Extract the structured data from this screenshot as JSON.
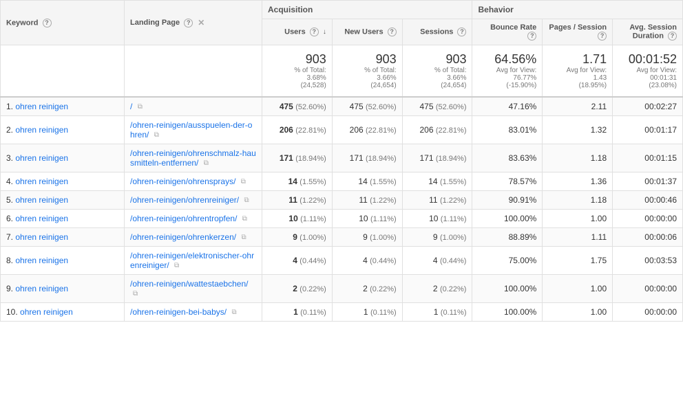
{
  "headers": {
    "keyword_label": "Keyword",
    "landing_label": "Landing Page",
    "acquisition_label": "Acquisition",
    "behavior_label": "Behavior",
    "users_label": "Users",
    "newusers_label": "New Users",
    "sessions_label": "Sessions",
    "bounce_label": "Bounce Rate",
    "pages_label": "Pages / Session",
    "avgdur_label": "Avg. Session Duration"
  },
  "summary": {
    "users": "903",
    "users_sub1": "% of Total:",
    "users_sub2": "3.68%",
    "users_sub3": "(24,528)",
    "newusers": "903",
    "newusers_sub1": "% of Total:",
    "newusers_sub2": "3.66%",
    "newusers_sub3": "(24,654)",
    "sessions": "903",
    "sessions_sub1": "% of Total:",
    "sessions_sub2": "3.66%",
    "sessions_sub3": "(24,654)",
    "bounce": "64.56%",
    "bounce_sub1": "Avg for View:",
    "bounce_sub2": "76.77%",
    "bounce_sub3": "(-15.90%)",
    "pages": "1.71",
    "pages_sub1": "Avg for View:",
    "pages_sub2": "1.43",
    "pages_sub3": "(18.95%)",
    "avgdur": "00:01:52",
    "avgdur_sub1": "Avg for View:",
    "avgdur_sub2": "00:01:31",
    "avgdur_sub3": "(23.08%)"
  },
  "rows": [
    {
      "num": "1.",
      "keyword": "ohren reinigen",
      "landing": "/",
      "users": "475",
      "users_pct": "(52.60%)",
      "newusers": "475",
      "newusers_pct": "(52.60%)",
      "sessions": "475",
      "sessions_pct": "(52.60%)",
      "bounce": "47.16%",
      "pages": "2.11",
      "avgdur": "00:02:27"
    },
    {
      "num": "2.",
      "keyword": "ohren reinigen",
      "landing": "/ohren-reinigen/ausspuelen-der-ohren/",
      "users": "206",
      "users_pct": "(22.81%)",
      "newusers": "206",
      "newusers_pct": "(22.81%)",
      "sessions": "206",
      "sessions_pct": "(22.81%)",
      "bounce": "83.01%",
      "pages": "1.32",
      "avgdur": "00:01:17"
    },
    {
      "num": "3.",
      "keyword": "ohren reinigen",
      "landing": "/ohren-reinigen/ohrenschmalz-hausmitteln-entfernen/",
      "users": "171",
      "users_pct": "(18.94%)",
      "newusers": "171",
      "newusers_pct": "(18.94%)",
      "sessions": "171",
      "sessions_pct": "(18.94%)",
      "bounce": "83.63%",
      "pages": "1.18",
      "avgdur": "00:01:15"
    },
    {
      "num": "4.",
      "keyword": "ohren reinigen",
      "landing": "/ohren-reinigen/ohrensprays/",
      "users": "14",
      "users_pct": "(1.55%)",
      "newusers": "14",
      "newusers_pct": "(1.55%)",
      "sessions": "14",
      "sessions_pct": "(1.55%)",
      "bounce": "78.57%",
      "pages": "1.36",
      "avgdur": "00:01:37"
    },
    {
      "num": "5.",
      "keyword": "ohren reinigen",
      "landing": "/ohren-reinigen/ohrenreiniger/",
      "users": "11",
      "users_pct": "(1.22%)",
      "newusers": "11",
      "newusers_pct": "(1.22%)",
      "sessions": "11",
      "sessions_pct": "(1.22%)",
      "bounce": "90.91%",
      "pages": "1.18",
      "avgdur": "00:00:46"
    },
    {
      "num": "6.",
      "keyword": "ohren reinigen",
      "landing": "/ohren-reinigen/ohrentropfen/",
      "users": "10",
      "users_pct": "(1.11%)",
      "newusers": "10",
      "newusers_pct": "(1.11%)",
      "sessions": "10",
      "sessions_pct": "(1.11%)",
      "bounce": "100.00%",
      "pages": "1.00",
      "avgdur": "00:00:00"
    },
    {
      "num": "7.",
      "keyword": "ohren reinigen",
      "landing": "/ohren-reinigen/ohrenkerzen/",
      "users": "9",
      "users_pct": "(1.00%)",
      "newusers": "9",
      "newusers_pct": "(1.00%)",
      "sessions": "9",
      "sessions_pct": "(1.00%)",
      "bounce": "88.89%",
      "pages": "1.11",
      "avgdur": "00:00:06"
    },
    {
      "num": "8.",
      "keyword": "ohren reinigen",
      "landing": "/ohren-reinigen/elektronischer-ohrenreiniger/",
      "users": "4",
      "users_pct": "(0.44%)",
      "newusers": "4",
      "newusers_pct": "(0.44%)",
      "sessions": "4",
      "sessions_pct": "(0.44%)",
      "bounce": "75.00%",
      "pages": "1.75",
      "avgdur": "00:03:53"
    },
    {
      "num": "9.",
      "keyword": "ohren reinigen",
      "landing": "/ohren-reinigen/wattestaebchen/",
      "users": "2",
      "users_pct": "(0.22%)",
      "newusers": "2",
      "newusers_pct": "(0.22%)",
      "sessions": "2",
      "sessions_pct": "(0.22%)",
      "bounce": "100.00%",
      "pages": "1.00",
      "avgdur": "00:00:00"
    },
    {
      "num": "10.",
      "keyword": "ohren reinigen",
      "landing": "/ohren-reinigen-bei-babys/",
      "users": "1",
      "users_pct": "(0.11%)",
      "newusers": "1",
      "newusers_pct": "(0.11%)",
      "sessions": "1",
      "sessions_pct": "(0.11%)",
      "bounce": "100.00%",
      "pages": "1.00",
      "avgdur": "00:00:00"
    }
  ]
}
